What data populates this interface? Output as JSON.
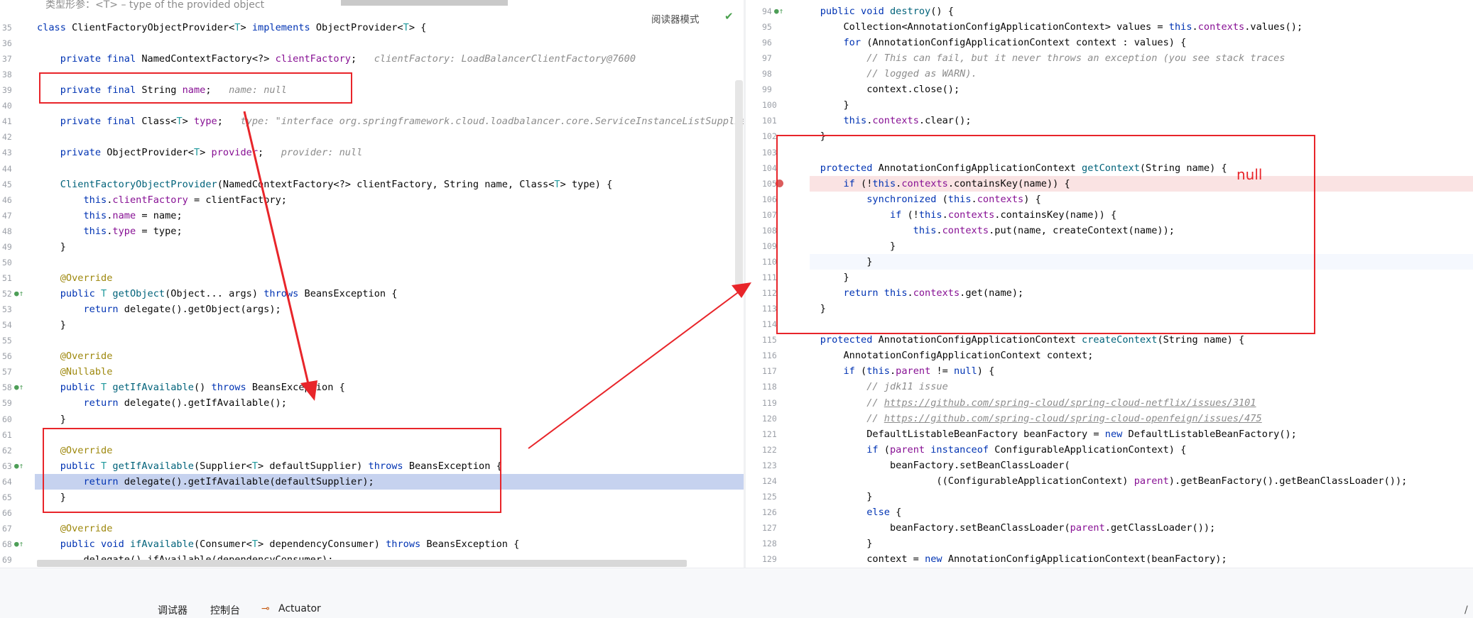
{
  "left_editor": {
    "top_fragment": "类型形参：<T> – type of the provided object",
    "reader_mode": "阅读器模式",
    "lines": [
      {
        "n": "35",
        "t": [
          [
            "kw",
            "class "
          ],
          [
            "",
            "ClientFactoryObjectProvider<"
          ],
          [
            "tp",
            "T"
          ],
          [
            "",
            "> "
          ],
          [
            "kw",
            "implements "
          ],
          [
            "",
            "ObjectProvider<"
          ],
          [
            "tp",
            "T"
          ],
          [
            "",
            "> {"
          ]
        ]
      },
      {
        "n": "36",
        "t": []
      },
      {
        "n": "37",
        "t": [
          [
            "kw",
            "    private final "
          ],
          [
            "",
            "NamedContextFactory<?> "
          ],
          [
            "fl",
            "clientFactory"
          ],
          [
            "",
            ";  "
          ],
          [
            "hint",
            " clientFactory: LoadBalancerClientFactory@7600"
          ]
        ]
      },
      {
        "n": "38",
        "t": []
      },
      {
        "n": "39",
        "t": [
          [
            "kw",
            "    private final "
          ],
          [
            "",
            "String "
          ],
          [
            "fl",
            "name"
          ],
          [
            "",
            ";  "
          ],
          [
            "hint",
            " name: null"
          ]
        ]
      },
      {
        "n": "40",
        "t": []
      },
      {
        "n": "41",
        "t": [
          [
            "kw",
            "    private final "
          ],
          [
            "",
            "Class<"
          ],
          [
            "tp",
            "T"
          ],
          [
            "",
            "> "
          ],
          [
            "fl",
            "type"
          ],
          [
            "",
            ";  "
          ],
          [
            "hint",
            " type: \"interface org.springframework.cloud.loadbalancer.core.ServiceInstanceListSupplier\""
          ]
        ]
      },
      {
        "n": "42",
        "t": []
      },
      {
        "n": "43",
        "t": [
          [
            "kw",
            "    private "
          ],
          [
            "",
            "ObjectProvider<"
          ],
          [
            "tp",
            "T"
          ],
          [
            "",
            "> "
          ],
          [
            "fl",
            "provider"
          ],
          [
            "",
            ";  "
          ],
          [
            "hint",
            " provider: null"
          ]
        ]
      },
      {
        "n": "44",
        "t": []
      },
      {
        "n": "45",
        "t": [
          [
            "ty",
            "    ClientFactoryObjectProvider"
          ],
          [
            "",
            "(NamedContextFactory<?> clientFactory, String name, Class<"
          ],
          [
            "tp",
            "T"
          ],
          [
            "",
            "> type) {"
          ]
        ]
      },
      {
        "n": "46",
        "t": [
          [
            "kw",
            "        this"
          ],
          [
            "",
            "."
          ],
          [
            "fl",
            "clientFactory"
          ],
          [
            "",
            " = clientFactory;"
          ]
        ]
      },
      {
        "n": "47",
        "t": [
          [
            "kw",
            "        this"
          ],
          [
            "",
            "."
          ],
          [
            "fl",
            "name"
          ],
          [
            "",
            " = name;"
          ]
        ]
      },
      {
        "n": "48",
        "t": [
          [
            "kw",
            "        this"
          ],
          [
            "",
            "."
          ],
          [
            "fl",
            "type"
          ],
          [
            "",
            " = type;"
          ]
        ]
      },
      {
        "n": "49",
        "t": [
          [
            "",
            "    }"
          ]
        ]
      },
      {
        "n": "50",
        "t": []
      },
      {
        "n": "51",
        "t": [
          [
            "an",
            "    @Override"
          ]
        ]
      },
      {
        "n": "52",
        "g": "●↑",
        "t": [
          [
            "kw",
            "    public "
          ],
          [
            "tp",
            "T "
          ],
          [
            "ty",
            "getObject"
          ],
          [
            "",
            "(Object... args) "
          ],
          [
            "kw",
            "throws "
          ],
          [
            "",
            "BeansException {"
          ]
        ]
      },
      {
        "n": "53",
        "t": [
          [
            "kw",
            "        return "
          ],
          [
            "",
            "delegate().getObject(args);"
          ]
        ]
      },
      {
        "n": "54",
        "t": [
          [
            "",
            "    }"
          ]
        ]
      },
      {
        "n": "55",
        "t": []
      },
      {
        "n": "56",
        "t": [
          [
            "an",
            "    @Override"
          ]
        ]
      },
      {
        "n": "57",
        "t": [
          [
            "an",
            "    @Nullable"
          ]
        ]
      },
      {
        "n": "58",
        "g": "●↑",
        "t": [
          [
            "kw",
            "    public "
          ],
          [
            "tp",
            "T "
          ],
          [
            "ty",
            "getIfAvailable"
          ],
          [
            "",
            "() "
          ],
          [
            "kw",
            "throws "
          ],
          [
            "",
            "BeansException {"
          ]
        ]
      },
      {
        "n": "59",
        "t": [
          [
            "kw",
            "        return "
          ],
          [
            "",
            "delegate().getIfAvailable();"
          ]
        ]
      },
      {
        "n": "60",
        "t": [
          [
            "",
            "    }"
          ]
        ]
      },
      {
        "n": "61",
        "t": []
      },
      {
        "n": "62",
        "t": [
          [
            "an",
            "    @Override"
          ]
        ]
      },
      {
        "n": "63",
        "g": "●↑",
        "t": [
          [
            "kw",
            "    public "
          ],
          [
            "tp",
            "T "
          ],
          [
            "ty",
            "getIfAvailable"
          ],
          [
            "",
            "(Supplier<"
          ],
          [
            "tp",
            "T"
          ],
          [
            "",
            "> defaultSupplier) "
          ],
          [
            "kw",
            "throws "
          ],
          [
            "",
            "BeansException {"
          ]
        ]
      },
      {
        "n": "64",
        "hl": "cur",
        "t": [
          [
            "kw",
            "        return "
          ],
          [
            "",
            "delegate().getIfAvailable(defaultSupplier);"
          ]
        ]
      },
      {
        "n": "65",
        "t": [
          [
            "",
            "    }"
          ]
        ]
      },
      {
        "n": "66",
        "t": []
      },
      {
        "n": "67",
        "t": [
          [
            "an",
            "    @Override"
          ]
        ]
      },
      {
        "n": "68",
        "g": "●↑",
        "t": [
          [
            "kw",
            "    public void "
          ],
          [
            "ty",
            "ifAvailable"
          ],
          [
            "",
            "(Consumer<"
          ],
          [
            "tp",
            "T"
          ],
          [
            "",
            "> dependencyConsumer) "
          ],
          [
            "kw",
            "throws "
          ],
          [
            "",
            "BeansException {"
          ]
        ]
      },
      {
        "n": "69",
        "t": [
          [
            "",
            "        delegate().ifAvailable(dependencyConsumer);"
          ]
        ]
      }
    ]
  },
  "right_editor": {
    "lines": [
      {
        "n": "94",
        "g": "●↑",
        "t": [
          [
            "kw",
            "    public void "
          ],
          [
            "ty",
            "destroy"
          ],
          [
            "",
            "() {"
          ]
        ]
      },
      {
        "n": "95",
        "t": [
          [
            "",
            "        Collection<AnnotationConfigApplicationContext> values = "
          ],
          [
            "kw",
            "this"
          ],
          [
            "",
            "."
          ],
          [
            "fl",
            "contexts"
          ],
          [
            "",
            ".values();"
          ]
        ]
      },
      {
        "n": "96",
        "t": [
          [
            "kw",
            "        for "
          ],
          [
            "",
            "(AnnotationConfigApplicationContext context : values) {"
          ]
        ]
      },
      {
        "n": "97",
        "t": [
          [
            "cm",
            "            // This can fail, but it never throws an exception (you see stack traces"
          ]
        ]
      },
      {
        "n": "98",
        "t": [
          [
            "cm",
            "            // logged as WARN)."
          ]
        ]
      },
      {
        "n": "99",
        "t": [
          [
            "",
            "            context.close();"
          ]
        ]
      },
      {
        "n": "100",
        "t": [
          [
            "",
            "        }"
          ]
        ]
      },
      {
        "n": "101",
        "t": [
          [
            "kw",
            "        this"
          ],
          [
            "",
            "."
          ],
          [
            "fl",
            "contexts"
          ],
          [
            "",
            ".clear();"
          ]
        ]
      },
      {
        "n": "102",
        "t": [
          [
            "",
            "    }"
          ]
        ]
      },
      {
        "n": "103",
        "t": []
      },
      {
        "n": "104",
        "t": [
          [
            "kw",
            "    protected "
          ],
          [
            "",
            "AnnotationConfigApplicationContext "
          ],
          [
            "ty",
            "getContext"
          ],
          [
            "",
            "(String name) {"
          ]
        ]
      },
      {
        "n": "105",
        "hl": "bp",
        "t": [
          [
            "kw",
            "        if "
          ],
          [
            "",
            "(!"
          ],
          [
            "kw",
            "this"
          ],
          [
            "",
            "."
          ],
          [
            "fl",
            "contexts"
          ],
          [
            "",
            ".containsKey(name)) {"
          ]
        ]
      },
      {
        "n": "106",
        "t": [
          [
            "kw",
            "            synchronized "
          ],
          [
            "",
            "("
          ],
          [
            "kw",
            "this"
          ],
          [
            "",
            "."
          ],
          [
            "fl",
            "contexts"
          ],
          [
            "",
            ") {"
          ]
        ]
      },
      {
        "n": "107",
        "t": [
          [
            "kw",
            "                if "
          ],
          [
            "",
            "(!"
          ],
          [
            "kw",
            "this"
          ],
          [
            "",
            "."
          ],
          [
            "fl",
            "contexts"
          ],
          [
            "",
            ".containsKey(name)) {"
          ]
        ]
      },
      {
        "n": "108",
        "t": [
          [
            "kw",
            "                    this"
          ],
          [
            "",
            "."
          ],
          [
            "fl",
            "contexts"
          ],
          [
            "",
            ".put(name, createContext(name));"
          ]
        ]
      },
      {
        "n": "109",
        "t": [
          [
            "",
            "                }"
          ]
        ]
      },
      {
        "n": "110",
        "hl": "caret",
        "t": [
          [
            "",
            "            }"
          ]
        ]
      },
      {
        "n": "111",
        "t": [
          [
            "",
            "        }"
          ]
        ]
      },
      {
        "n": "112",
        "t": [
          [
            "kw",
            "        return this"
          ],
          [
            "",
            "."
          ],
          [
            "fl",
            "contexts"
          ],
          [
            "",
            ".get(name);"
          ]
        ]
      },
      {
        "n": "113",
        "t": [
          [
            "",
            "    }"
          ]
        ]
      },
      {
        "n": "114",
        "t": []
      },
      {
        "n": "115",
        "t": [
          [
            "kw",
            "    protected "
          ],
          [
            "",
            "AnnotationConfigApplicationContext "
          ],
          [
            "ty",
            "createContext"
          ],
          [
            "",
            "(String name) {"
          ]
        ]
      },
      {
        "n": "116",
        "t": [
          [
            "",
            "        AnnotationConfigApplicationContext context;"
          ]
        ]
      },
      {
        "n": "117",
        "t": [
          [
            "kw",
            "        if "
          ],
          [
            "",
            "("
          ],
          [
            "kw",
            "this"
          ],
          [
            "",
            "."
          ],
          [
            "fl",
            "parent"
          ],
          [
            "",
            " != "
          ],
          [
            "kw",
            "null"
          ],
          [
            "",
            ") {"
          ]
        ]
      },
      {
        "n": "118",
        "t": [
          [
            "cm",
            "            // jdk11 issue"
          ]
        ]
      },
      {
        "n": "119",
        "t": [
          [
            "cm",
            "            // "
          ],
          [
            "link",
            "https://github.com/spring-cloud/spring-cloud-netflix/issues/3101"
          ]
        ]
      },
      {
        "n": "120",
        "t": [
          [
            "cm",
            "            // "
          ],
          [
            "link",
            "https://github.com/spring-cloud/spring-cloud-openfeign/issues/475"
          ]
        ]
      },
      {
        "n": "121",
        "t": [
          [
            "",
            "            DefaultListableBeanFactory beanFactory = "
          ],
          [
            "kw",
            "new "
          ],
          [
            "",
            "DefaultListableBeanFactory();"
          ]
        ]
      },
      {
        "n": "122",
        "t": [
          [
            "kw",
            "            if "
          ],
          [
            "",
            "("
          ],
          [
            "fl",
            "parent"
          ],
          [
            "kw",
            " instanceof "
          ],
          [
            "",
            "ConfigurableApplicationContext) {"
          ]
        ]
      },
      {
        "n": "123",
        "t": [
          [
            "",
            "                beanFactory.setBeanClassLoader("
          ]
        ]
      },
      {
        "n": "124",
        "t": [
          [
            "",
            "                        ((ConfigurableApplicationContext) "
          ],
          [
            "fl",
            "parent"
          ],
          [
            "",
            ").getBeanFactory().getBeanClassLoader());"
          ]
        ]
      },
      {
        "n": "125",
        "t": [
          [
            "",
            "            }"
          ]
        ]
      },
      {
        "n": "126",
        "t": [
          [
            "kw",
            "            else "
          ],
          [
            "",
            "{"
          ]
        ]
      },
      {
        "n": "127",
        "t": [
          [
            "",
            "                beanFactory.setBeanClassLoader("
          ],
          [
            "fl",
            "parent"
          ],
          [
            "",
            ".getClassLoader());"
          ]
        ]
      },
      {
        "n": "128",
        "t": [
          [
            "",
            "            }"
          ]
        ]
      },
      {
        "n": "129",
        "t": [
          [
            "",
            "            context = "
          ],
          [
            "kw",
            "new "
          ],
          [
            "",
            "AnnotationConfigApplicationContext(beanFactory);"
          ]
        ]
      }
    ]
  },
  "annotation": {
    "note": "null"
  },
  "bottom_tabs": {
    "debugger": "调试器",
    "console": "控制台",
    "actuator": "Actuator",
    "corner": "/"
  },
  "colors": {
    "highlight_box": "#e8252a",
    "current_line": "#c6d2ef",
    "breakpoint_line": "#fae3e3",
    "breakpoint": "#db5c5c"
  }
}
